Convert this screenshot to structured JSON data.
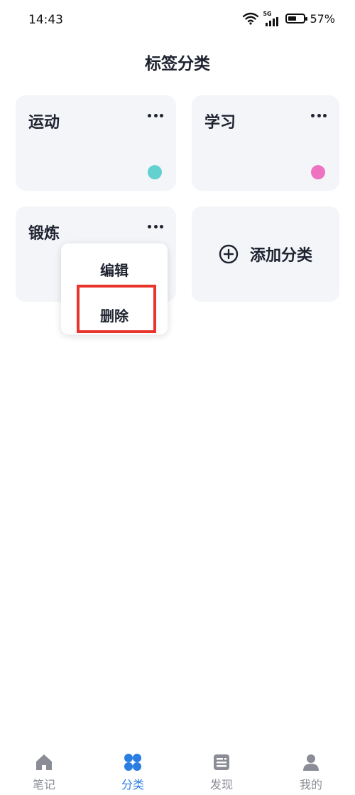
{
  "status": {
    "time": "14:43",
    "network": "5G",
    "battery": "57%",
    "battery_level": 0.57
  },
  "header": {
    "title": "标签分类"
  },
  "categories": [
    {
      "name": "运动",
      "dot_color": "#62d1cf"
    },
    {
      "name": "学习",
      "dot_color": "#ee72c0"
    },
    {
      "name": "锻炼"
    }
  ],
  "add_category": {
    "label": "添加分类",
    "icon": "plus-circle-icon"
  },
  "context_menu": {
    "edit_label": "编辑",
    "delete_label": "删除",
    "highlight_color": "#e8342b"
  },
  "tabbar": {
    "active_color": "#2a7de1",
    "inactive_color": "#8a8d96",
    "tabs": [
      {
        "label": "笔记",
        "icon": "home-icon"
      },
      {
        "label": "分类",
        "icon": "category-icon",
        "active": true
      },
      {
        "label": "发现",
        "icon": "news-icon"
      },
      {
        "label": "我的",
        "icon": "profile-icon"
      }
    ]
  }
}
